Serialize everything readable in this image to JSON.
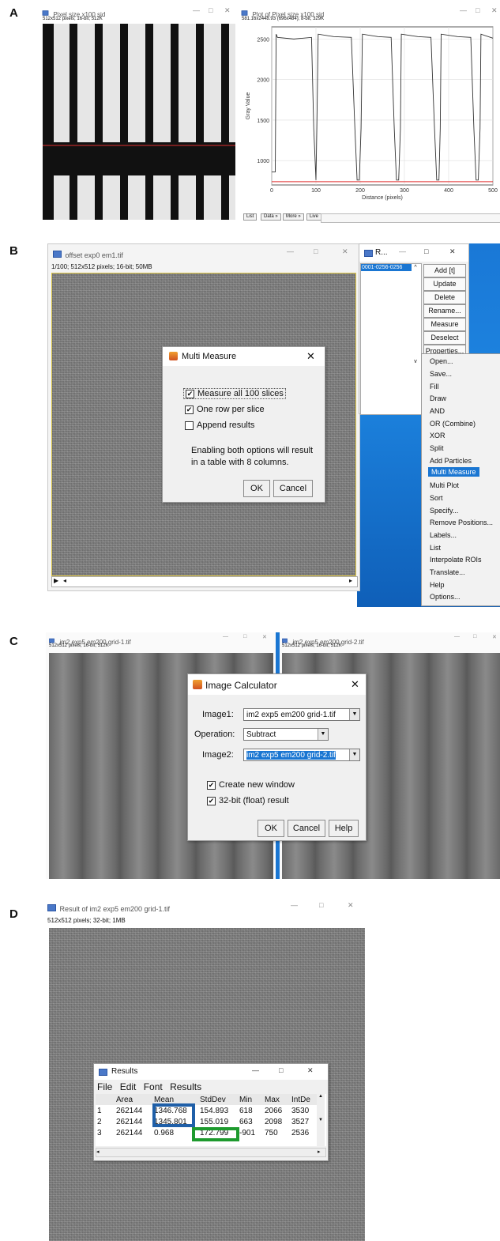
{
  "panels": {
    "a": "A",
    "b": "B",
    "c": "C",
    "d": "D"
  },
  "panel_a": {
    "image_window": {
      "title": "Pixel size x100 sid",
      "info": "512x512 pixels; 16-bit; 512K"
    },
    "plot_window": {
      "title": "Plot of Pixel size x100 sid",
      "info": "581.16x2448.93 (696x484); 8-bit; 329K"
    },
    "plot_buttons": [
      "List",
      "Data »",
      "More »",
      "Live"
    ],
    "win_controls": [
      "—",
      "□",
      "✕"
    ],
    "chart_data": {
      "type": "line",
      "title": "",
      "xlabel": "Distance (pixels)",
      "ylabel": "Gray Value",
      "xlim": [
        0,
        500
      ],
      "ylim": [
        700,
        2650
      ],
      "x_ticks": [
        0,
        100,
        200,
        300,
        400,
        500
      ],
      "y_ticks": [
        1000,
        1500,
        2000,
        2500
      ],
      "grid": true,
      "series": [
        {
          "color": "#333333",
          "x": [
            0,
            8,
            10,
            13,
            50,
            90,
            95,
            100,
            102,
            105,
            140,
            180,
            188,
            193,
            198,
            202,
            205,
            240,
            270,
            277,
            282,
            287,
            291,
            293,
            330,
            360,
            368,
            373,
            378,
            381,
            383,
            420,
            450,
            457,
            462,
            467,
            471,
            473,
            505
          ],
          "y": [
            860,
            860,
            2560,
            2520,
            2500,
            2520,
            1400,
            760,
            1400,
            2560,
            2530,
            2520,
            1400,
            760,
            760,
            1400,
            2560,
            2530,
            2520,
            1400,
            760,
            760,
            1400,
            2560,
            2530,
            2520,
            1400,
            760,
            760,
            1400,
            2560,
            2530,
            2520,
            1400,
            760,
            760,
            1400,
            2560,
            2510
          ]
        }
      ],
      "baseline": {
        "color": "#e03030",
        "y": 740
      }
    }
  },
  "panel_b": {
    "image_window": {
      "title": "offset exp0 em1.tif",
      "info": "1/100; 512x512 pixels; 16-bit; 50MB"
    },
    "dialog": {
      "title": "Multi Measure",
      "options": [
        {
          "label": "Measure all 100 slices",
          "checked": true
        },
        {
          "label": "One row per slice",
          "checked": true
        },
        {
          "label": "Append results",
          "checked": false
        }
      ],
      "note_line1": "Enabling both options will result",
      "note_line2": "in a table with 8 columns.",
      "ok": "OK",
      "cancel": "Cancel",
      "close": "✕"
    },
    "roi_manager": {
      "title": "R...",
      "list_item": "0001-0256-0256",
      "buttons": [
        "Add [t]",
        "Update",
        "Delete",
        "Rename...",
        "Measure",
        "Deselect",
        "Properties..."
      ]
    },
    "more_menu": {
      "items": [
        "Open...",
        "Save...",
        "Fill",
        "Draw",
        "AND",
        "OR (Combine)",
        "XOR",
        "Split",
        "Add Particles",
        "Multi Measure",
        "Multi Plot",
        "Sort",
        "Specify...",
        "Remove Positions...",
        "Labels...",
        "List",
        "Interpolate ROIs",
        "Translate...",
        "Help",
        "Options..."
      ],
      "selected": "Multi Measure"
    },
    "accent_color": "#1a76d2"
  },
  "panel_c": {
    "left_window": {
      "title": "im2 exp5 em200 grid-1.tif",
      "info": "512x512 pixels; 16-bit; 512K"
    },
    "right_window": {
      "title": "im2 exp5 em200 grid-2.tif",
      "info": "512x512 pixels; 16-bit; 512K"
    },
    "dialog": {
      "title": "Image Calculator",
      "image1_label": "Image1:",
      "image1_value": "im2 exp5 em200 grid-1.tif",
      "operation_label": "Operation:",
      "operation_value": "Subtract",
      "image2_label": "Image2:",
      "image2_value": "im2 exp5 em200 grid-2.tif",
      "options": [
        {
          "label": "Create new window",
          "checked": true
        },
        {
          "label": "32-bit (float) result",
          "checked": true
        }
      ],
      "ok": "OK",
      "cancel": "Cancel",
      "help": "Help",
      "close": "✕"
    }
  },
  "panel_d": {
    "image_window": {
      "title": "Result of im2 exp5 em200 grid-1.tif",
      "info": "512x512 pixels; 32-bit; 1MB"
    },
    "results": {
      "title": "Results",
      "menu": [
        "File",
        "Edit",
        "Font",
        "Results"
      ],
      "columns": [
        "",
        "Area",
        "Mean",
        "StdDev",
        "Min",
        "Max",
        "IntDe"
      ],
      "rows": [
        [
          "1",
          "262144",
          "1346.768",
          "154.893",
          "618",
          "2066",
          "3530"
        ],
        [
          "2",
          "262144",
          "1345.801",
          "155.019",
          "663",
          "2098",
          "3527"
        ],
        [
          "3",
          "262144",
          "0.968",
          "172.799",
          "-901",
          "750",
          "2536"
        ]
      ],
      "highlight_mean_color": "#1f5fa8",
      "highlight_std_color": "#1e9a2e"
    }
  }
}
